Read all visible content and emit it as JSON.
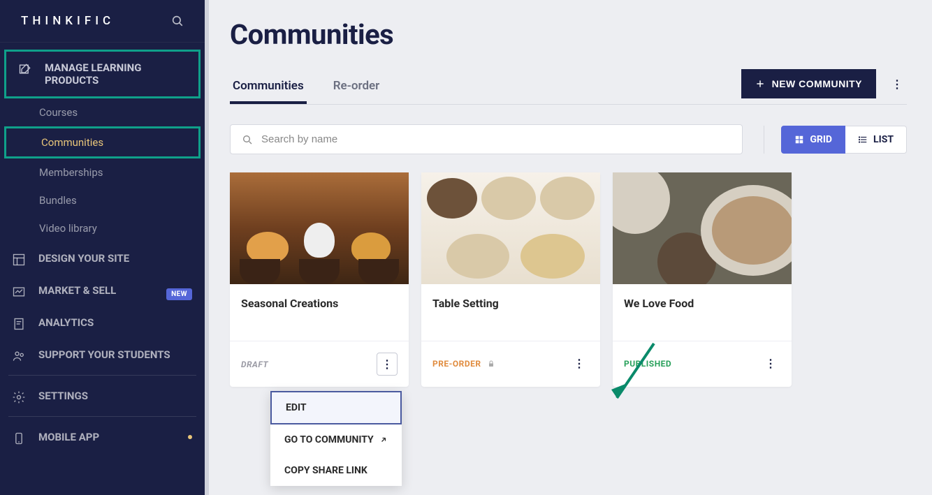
{
  "brand": "THINKIFIC",
  "nav": {
    "manage": "MANAGE LEARNING PRODUCTS",
    "items": [
      "Courses",
      "Communities",
      "Memberships",
      "Bundles",
      "Video library"
    ],
    "design": "DESIGN YOUR SITE",
    "market": "MARKET & SELL",
    "new_badge": "NEW",
    "analytics": "ANALYTICS",
    "support": "SUPPORT YOUR STUDENTS",
    "settings": "SETTINGS",
    "mobile": "MOBILE APP"
  },
  "page_title": "Communities",
  "tabs": [
    "Communities",
    "Re-order"
  ],
  "new_btn": "NEW COMMUNITY",
  "search_placeholder": "Search by name",
  "view": {
    "grid": "GRID",
    "list": "LIST"
  },
  "cards": [
    {
      "title": "Seasonal Creations",
      "status": "DRAFT"
    },
    {
      "title": "Table Setting",
      "status": "PRE-ORDER"
    },
    {
      "title": "We Love Food",
      "status": "PUBLISHED"
    }
  ],
  "dropdown": [
    "EDIT",
    "GO TO COMMUNITY",
    "COPY SHARE LINK"
  ]
}
